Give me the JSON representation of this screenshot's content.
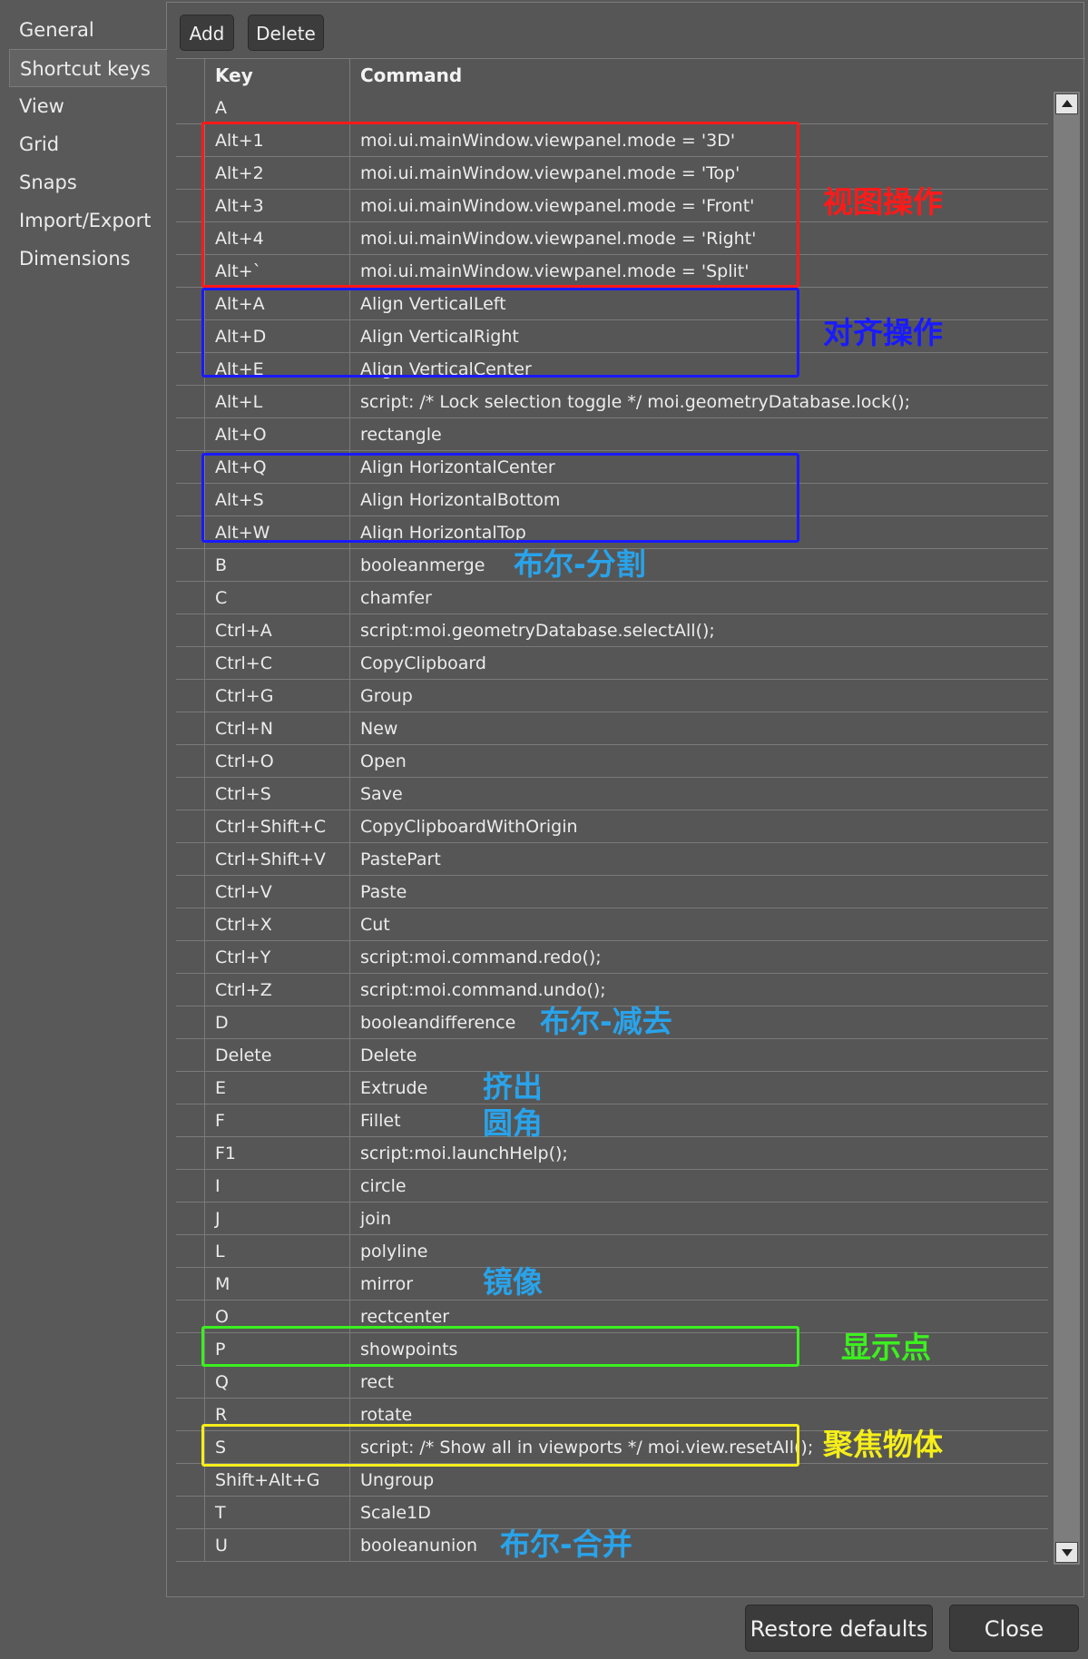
{
  "nav": {
    "items": [
      {
        "label": "General",
        "active": false
      },
      {
        "label": "Shortcut keys",
        "active": true
      },
      {
        "label": "View",
        "active": false
      },
      {
        "label": "Grid",
        "active": false
      },
      {
        "label": "Snaps",
        "active": false
      },
      {
        "label": "Import/Export",
        "active": false
      },
      {
        "label": "Dimensions",
        "active": false
      }
    ]
  },
  "toolbar": {
    "add_label": "Add",
    "delete_label": "Delete"
  },
  "table": {
    "columns": {
      "key": "Key",
      "command": "Command"
    },
    "rows": [
      {
        "key": "A",
        "command": ""
      },
      {
        "key": "Alt+1",
        "command": "moi.ui.mainWindow.viewpanel.mode = '3D'"
      },
      {
        "key": "Alt+2",
        "command": "moi.ui.mainWindow.viewpanel.mode = 'Top'"
      },
      {
        "key": "Alt+3",
        "command": "moi.ui.mainWindow.viewpanel.mode = 'Front'"
      },
      {
        "key": "Alt+4",
        "command": "moi.ui.mainWindow.viewpanel.mode = 'Right'"
      },
      {
        "key": "Alt+`",
        "command": "moi.ui.mainWindow.viewpanel.mode = 'Split'"
      },
      {
        "key": "Alt+A",
        "command": "Align VerticalLeft"
      },
      {
        "key": "Alt+D",
        "command": "Align VerticalRight"
      },
      {
        "key": "Alt+E",
        "command": "Align VerticalCenter"
      },
      {
        "key": "Alt+L",
        "command": "script: /* Lock selection toggle */ moi.geometryDatabase.lock();"
      },
      {
        "key": "Alt+O",
        "command": "rectangle"
      },
      {
        "key": "Alt+Q",
        "command": "Align HorizontalCenter"
      },
      {
        "key": "Alt+S",
        "command": "Align HorizontalBottom"
      },
      {
        "key": "Alt+W",
        "command": "Align HorizontalTop"
      },
      {
        "key": "B",
        "command": "booleanmerge"
      },
      {
        "key": "C",
        "command": "chamfer"
      },
      {
        "key": "Ctrl+A",
        "command": "script:moi.geometryDatabase.selectAll();"
      },
      {
        "key": "Ctrl+C",
        "command": "CopyClipboard"
      },
      {
        "key": "Ctrl+G",
        "command": "Group"
      },
      {
        "key": "Ctrl+N",
        "command": "New"
      },
      {
        "key": "Ctrl+O",
        "command": "Open"
      },
      {
        "key": "Ctrl+S",
        "command": "Save"
      },
      {
        "key": "Ctrl+Shift+C",
        "command": "CopyClipboardWithOrigin"
      },
      {
        "key": "Ctrl+Shift+V",
        "command": "PastePart"
      },
      {
        "key": "Ctrl+V",
        "command": "Paste"
      },
      {
        "key": "Ctrl+X",
        "command": "Cut"
      },
      {
        "key": "Ctrl+Y",
        "command": "script:moi.command.redo();"
      },
      {
        "key": "Ctrl+Z",
        "command": "script:moi.command.undo();"
      },
      {
        "key": "D",
        "command": "booleandifference"
      },
      {
        "key": "Delete",
        "command": "Delete"
      },
      {
        "key": "E",
        "command": "Extrude"
      },
      {
        "key": "F",
        "command": "Fillet"
      },
      {
        "key": "F1",
        "command": "script:moi.launchHelp();"
      },
      {
        "key": "I",
        "command": "circle"
      },
      {
        "key": "J",
        "command": "join"
      },
      {
        "key": "L",
        "command": "polyline"
      },
      {
        "key": "M",
        "command": "mirror"
      },
      {
        "key": "O",
        "command": "rectcenter"
      },
      {
        "key": "P",
        "command": "showpoints"
      },
      {
        "key": "Q",
        "command": "rect"
      },
      {
        "key": "R",
        "command": "rotate"
      },
      {
        "key": "S",
        "command": "script: /* Show all in viewports */ moi.view.resetAll();"
      },
      {
        "key": "Shift+Alt+G",
        "command": "Ungroup"
      },
      {
        "key": "T",
        "command": "Scale1D"
      },
      {
        "key": "U",
        "command": "booleanunion"
      }
    ]
  },
  "annotations": {
    "view_ops": "视图操作",
    "align_ops": "对齐操作",
    "bool_split": "布尔-分割",
    "bool_subtract": "布尔-减去",
    "extrude": "挤出",
    "fillet": "圆角",
    "mirror": "镜像",
    "show_points": "显示点",
    "focus_object": "聚焦物体",
    "bool_union": "布尔-合并"
  },
  "colors": {
    "red": "#ff1a1a",
    "blue": "#1a1aff",
    "cyan": "#29a3ea",
    "green": "#3cf01f",
    "yellow": "#f5ee1a"
  },
  "footer": {
    "restore_label": "Restore defaults",
    "close_label": "Close"
  }
}
